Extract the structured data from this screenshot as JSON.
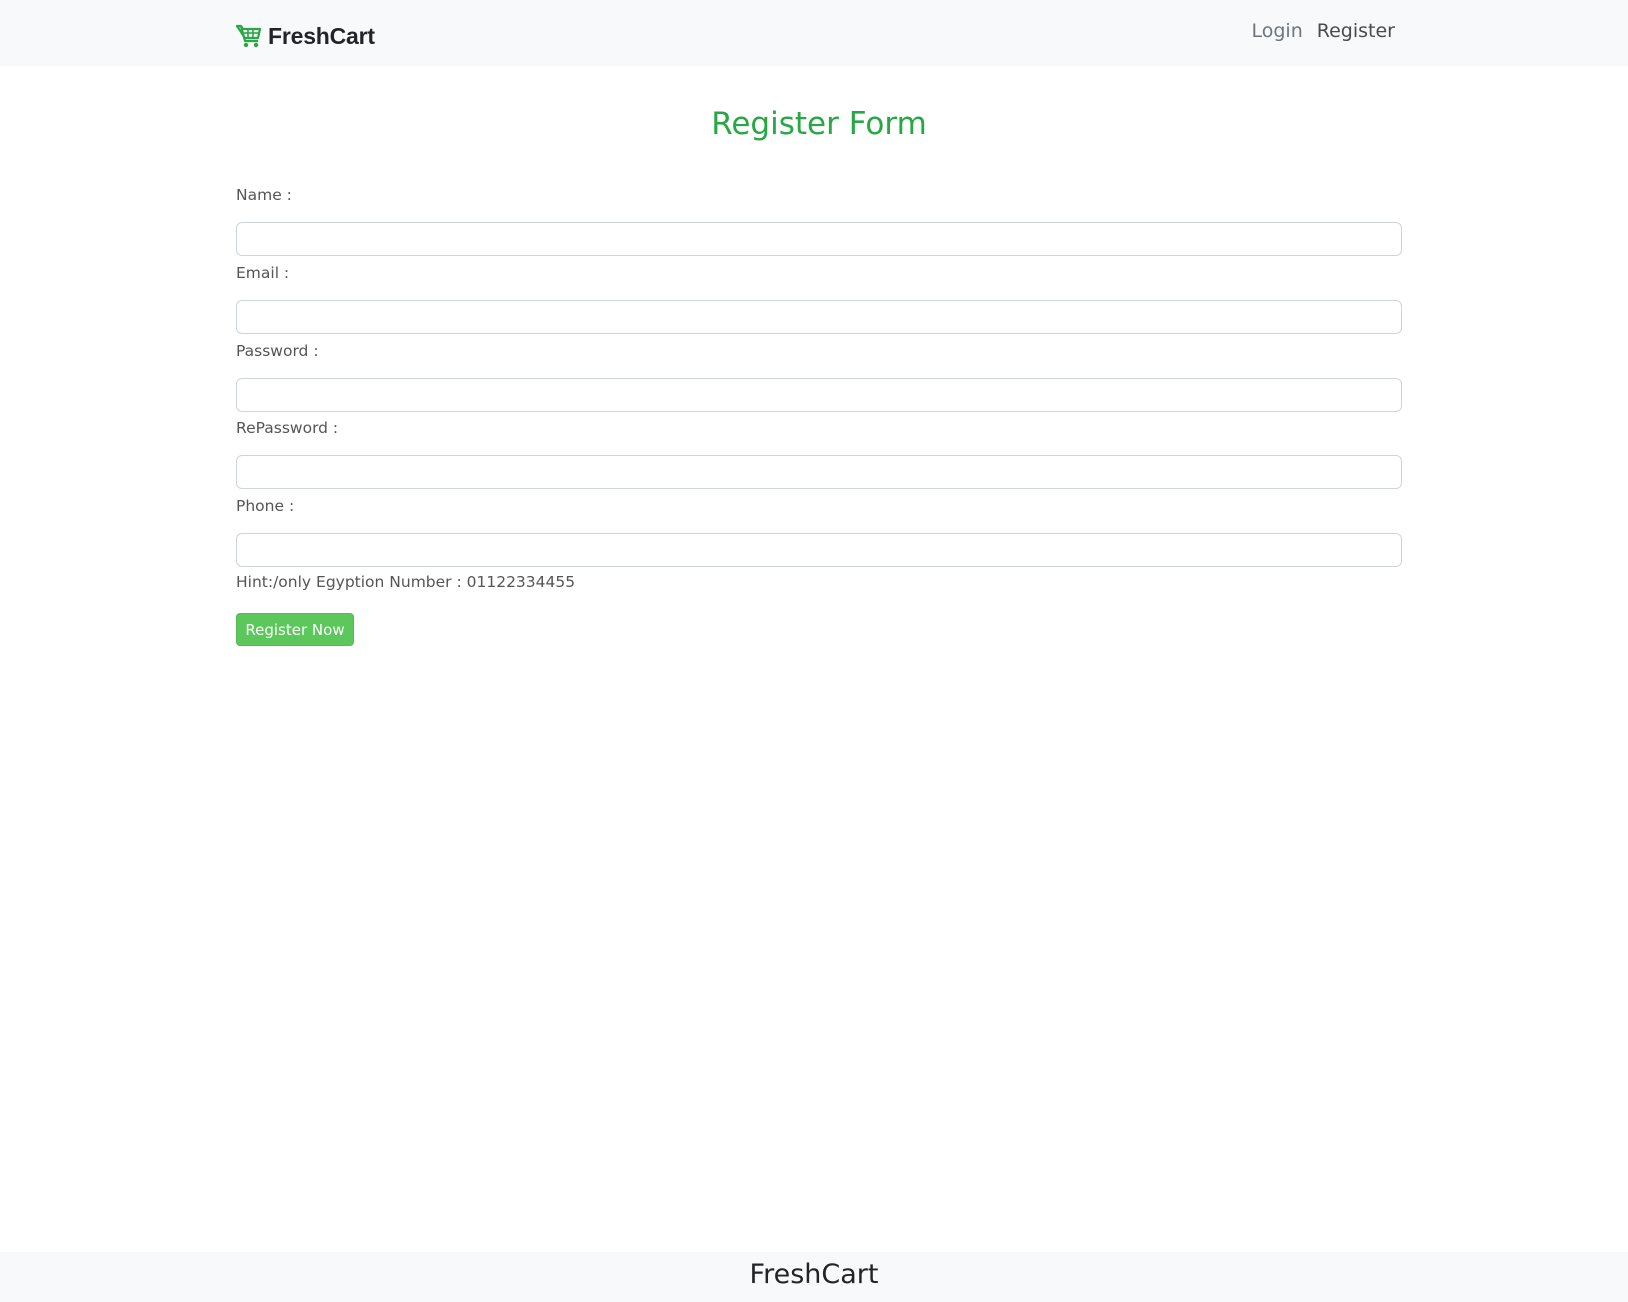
{
  "navbar": {
    "brand": "FreshCart",
    "brand_icon": "shopping-cart-icon",
    "brand_color": "#28a745",
    "links": [
      {
        "label": "Login"
      },
      {
        "label": "Register"
      }
    ]
  },
  "form": {
    "title": "Register Form",
    "title_color": "#28a745",
    "fields": [
      {
        "label": "Name :",
        "value": ""
      },
      {
        "label": "Email :",
        "value": ""
      },
      {
        "label": "Password :",
        "value": ""
      },
      {
        "label": "RePassword :",
        "value": ""
      },
      {
        "label": "Phone :",
        "value": ""
      }
    ],
    "hint": "Hint:/only Egyption Number : 01122334455",
    "submit_label": "Register Now",
    "submit_color": "#5cc85c"
  },
  "footer": {
    "text": "FreshCart"
  }
}
